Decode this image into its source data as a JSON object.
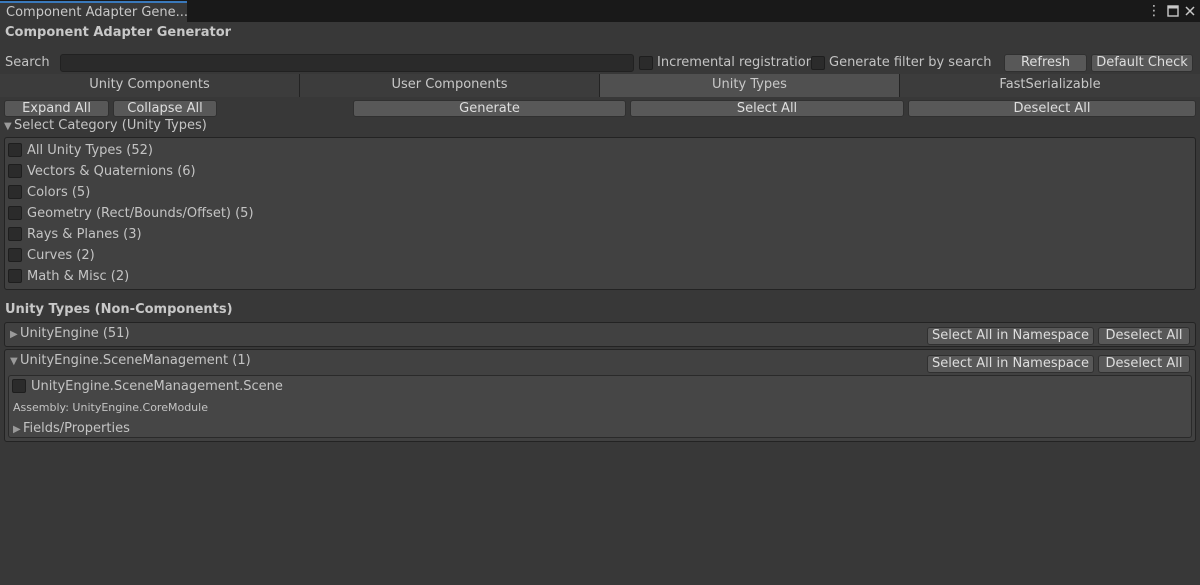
{
  "window": {
    "tab_title": "Component Adapter Gene...",
    "menu_icon": "kebab-menu-icon",
    "maximize_icon": "maximize-icon",
    "close_icon": "close-icon"
  },
  "header": {
    "title": "Component Adapter Generator"
  },
  "search": {
    "label": "Search",
    "value": "",
    "incremental_label": "Incremental registration",
    "filter_label": "Generate filter by search",
    "refresh_label": "Refresh",
    "default_check_label": "Default Check"
  },
  "tabs": [
    {
      "label": "Unity Components",
      "active": false
    },
    {
      "label": "User Components",
      "active": false
    },
    {
      "label": "Unity Types",
      "active": true
    },
    {
      "label": "FastSerializable",
      "active": false
    }
  ],
  "toolbar": {
    "expand_all": "Expand All",
    "collapse_all": "Collapse All",
    "generate": "Generate",
    "select_all": "Select All",
    "deselect_all": "Deselect All"
  },
  "category": {
    "title": "Select Category (Unity Types)",
    "items": [
      "All Unity Types (52)",
      "Vectors & Quaternions (6)",
      "Colors (5)",
      "Geometry (Rect/Bounds/Offset) (5)",
      "Rays & Planes (3)",
      "Curves (2)",
      "Math & Misc (2)"
    ]
  },
  "types": {
    "title": "Unity Types (Non-Components)",
    "namespaces": [
      {
        "name": "UnityEngine (51)",
        "expanded": false,
        "select_label": "Select All in Namespace",
        "deselect_label": "Deselect All"
      },
      {
        "name": "UnityEngine.SceneManagement (1)",
        "expanded": true,
        "select_label": "Select All in Namespace",
        "deselect_label": "Deselect All",
        "type": {
          "name": "UnityEngine.SceneManagement.Scene",
          "assembly": "Assembly: UnityEngine.CoreModule",
          "fields_label": "Fields/Properties"
        }
      }
    ]
  }
}
